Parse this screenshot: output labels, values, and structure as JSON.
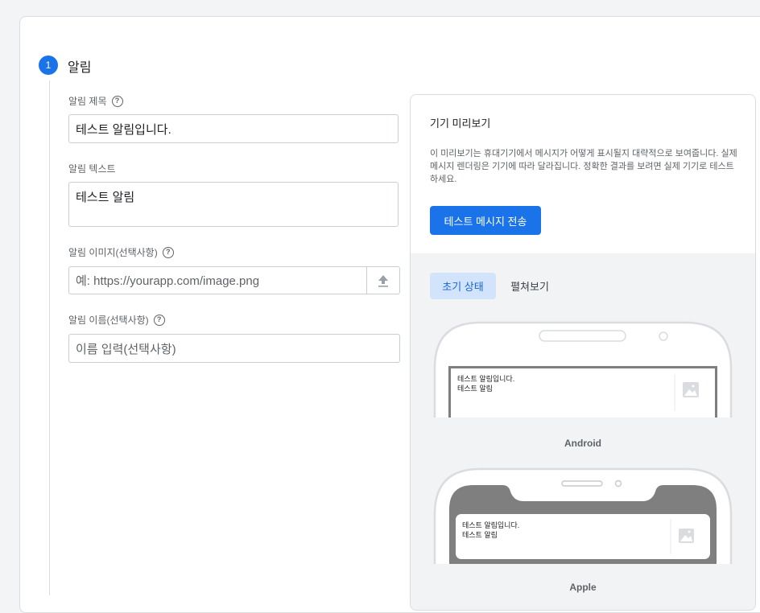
{
  "step": {
    "number": "1",
    "title": "알림"
  },
  "fields": {
    "title_label": "알림 제목",
    "title_value": "테스트 알림입니다.",
    "text_label": "알림 텍스트",
    "text_value": "테스트 알림",
    "image_label": "알림 이미지(선택사항)",
    "image_placeholder": "예: https://yourapp.com/image.png",
    "name_label": "알림 이름(선택사항)",
    "name_placeholder": "이름 입력(선택사항)"
  },
  "preview": {
    "title": "기기 미리보기",
    "description": "이 미리보기는 휴대기기에서 메시지가 어떻게 표시될지 대략적으로 보여줍니다. 실제 메시지 렌더링은 기기에 따라 달라집니다. 정확한 결과를 보려면 실제 기기로 테스트하세요.",
    "send_button": "테스트 메시지 전송",
    "tabs": [
      "초기 상태",
      "펼쳐보기"
    ],
    "android_label": "Android",
    "apple_label": "Apple",
    "notif_title": "테스트 알림입니다.",
    "notif_body": "테스트 알림"
  },
  "colors": {
    "accent": "#1a73e8",
    "tab_active_bg": "#d2e3fc"
  }
}
